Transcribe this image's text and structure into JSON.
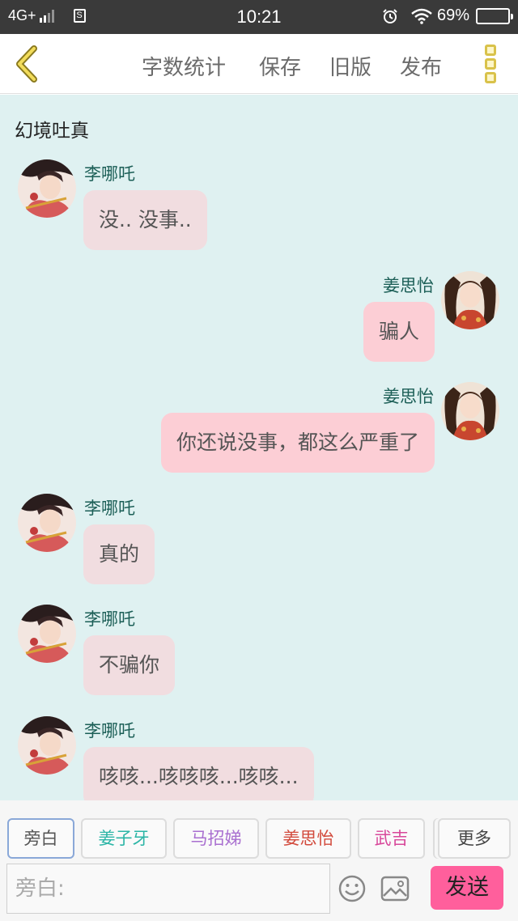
{
  "status_bar": {
    "network": "4G+",
    "sim_label": "S",
    "time": "10:21",
    "battery_percent": "69%",
    "battery_level": 0.69
  },
  "toolbar": {
    "back_icon": "chevron-left-icon",
    "items": [
      "字数统计",
      "保存",
      "旧版",
      "发布"
    ],
    "more_icon": "vertical-dots-icon",
    "accent_color": "#d9c24a"
  },
  "chat": {
    "title": "幻境吐真",
    "background_color": "#dff1f1",
    "messages": [
      {
        "side": "left",
        "sender": "李哪吒",
        "text": "没.. 没事..",
        "avatar": "nezha-avatar"
      },
      {
        "side": "right",
        "sender": "姜思怡",
        "text": "骗人",
        "avatar": "jiangsiyi-avatar"
      },
      {
        "side": "right",
        "sender": "姜思怡",
        "text": "你还说没事，都这么严重了",
        "avatar": "jiangsiyi-avatar"
      },
      {
        "side": "left",
        "sender": "李哪吒",
        "text": "真的",
        "avatar": "nezha-avatar"
      },
      {
        "side": "left",
        "sender": "李哪吒",
        "text": "不骗你",
        "avatar": "nezha-avatar"
      },
      {
        "side": "left",
        "sender": "李哪吒",
        "text": "咳咳...咳咳咳...咳咳...",
        "avatar": "nezha-avatar"
      }
    ]
  },
  "characters": {
    "tabs": [
      {
        "label": "旁白",
        "color": "#555555"
      },
      {
        "label": "姜子牙",
        "color": "#2bb5a6"
      },
      {
        "label": "马招娣",
        "color": "#a96fd0"
      },
      {
        "label": "姜思怡",
        "color": "#d24a3c"
      },
      {
        "label": "武吉",
        "color": "#d8479a"
      }
    ],
    "more_label": "更多"
  },
  "composer": {
    "placeholder": "旁白:",
    "emoji_icon": "smiley-icon",
    "image_icon": "image-icon",
    "send_label": "发送",
    "send_color": "#ff5f9c"
  }
}
